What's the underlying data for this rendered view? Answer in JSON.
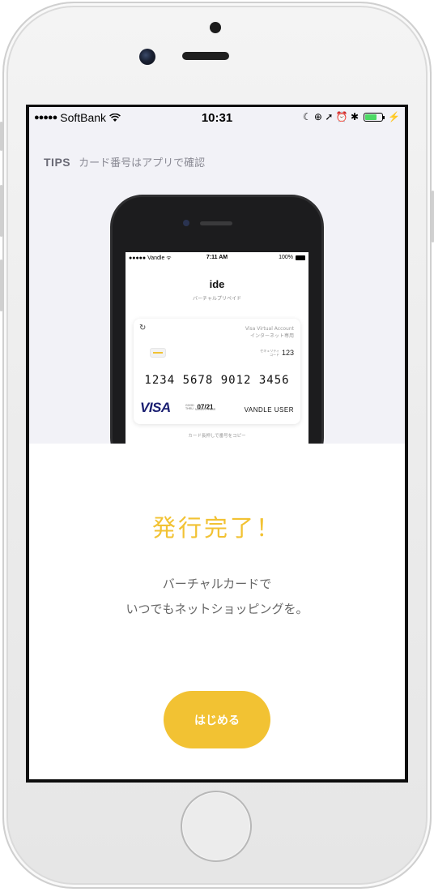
{
  "status_bar": {
    "signal": "●●●●●",
    "carrier": "SoftBank",
    "wifi_icon": "wifi-icon",
    "time": "10:31",
    "indicators": "☾ ⊕ ➚ ⏰ ✱",
    "battery_color": "#4cd964"
  },
  "tips": {
    "label": "TIPS",
    "text": "カード番号はアプリで確認"
  },
  "mini_phone": {
    "status": {
      "left": "●●●●● Vandle ᯤ",
      "time": "7:11 AM",
      "battery": "100%"
    },
    "app_title": "ide",
    "app_subtitle": "バーチャルプリペイド",
    "card": {
      "refresh_icon": "refresh-icon",
      "account_type": "Visa Virtual Account",
      "account_note": "インターネット専用",
      "security_label": "セキュリティコード",
      "security_code": "123",
      "number": "1234 5678 9012 3456",
      "brand": "VISA",
      "valid_label": "GOOD THRU",
      "expiry": "07/21",
      "expiry_sub": "MONTH / YEAR",
      "holder": "VANDLE USER"
    },
    "copy_hint": "カード長押しで番号をコピー"
  },
  "done": {
    "title": "発行完了！",
    "message_line1": "バーチャルカードで",
    "message_line2": "いつでもネットショッピングを。"
  },
  "start_button": {
    "label": "はじめる"
  },
  "colors": {
    "accent": "#f2c233",
    "tips_background": "#f2f2f7",
    "visa_blue": "#1a1f71"
  }
}
